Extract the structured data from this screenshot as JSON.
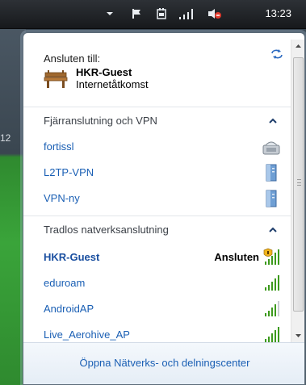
{
  "taskbar": {
    "time": "13:23",
    "icons": [
      "arrow-up-icon",
      "flag-icon",
      "power-plug-icon",
      "signal-icon",
      "speaker-muted-icon"
    ]
  },
  "desktop": {
    "side_text": "12"
  },
  "flyout": {
    "connected_label": "Ansluten till:",
    "current_network": {
      "name": "HKR-Guest",
      "status": "Internetåtkomst"
    },
    "sections": [
      {
        "label": "Fjärranslutning och VPN",
        "items": [
          {
            "label": "fortissl",
            "icon": "dialup-icon"
          },
          {
            "label": "L2TP-VPN",
            "icon": "vpn-tower-icon"
          },
          {
            "label": "VPN-ny",
            "icon": "vpn-tower-icon"
          }
        ]
      },
      {
        "label": "Tradlos natverksanslutning",
        "items": [
          {
            "label": "HKR-Guest",
            "status": "Ansluten",
            "icon": "wifi-shield-icon"
          },
          {
            "label": "eduroam",
            "icon": "wifi-signal-icon"
          },
          {
            "label": "AndroidAP",
            "icon": "wifi-signal-icon"
          },
          {
            "label": "Live_Aerohive_AP",
            "icon": "wifi-signal-icon"
          }
        ]
      }
    ],
    "footer_link": "Öppna Nätverks- och delningscenter"
  },
  "colors": {
    "link": "#1a5fb4",
    "signal_green": "#3c9a1c",
    "footer_bg": "#e9f0f8"
  }
}
